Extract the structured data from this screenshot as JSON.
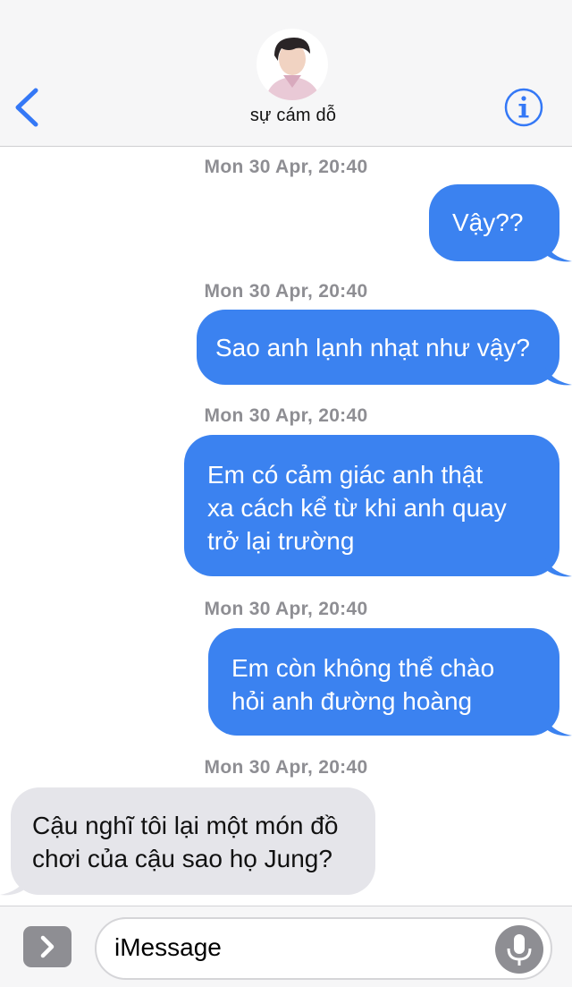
{
  "header": {
    "contact_name": "sự cám dỗ",
    "back_icon": "chevron-left-icon",
    "info_icon": "info-icon",
    "accent_color": "#3478f6"
  },
  "messages": [
    {
      "timestamp": "Mon 30 Apr, 20:40",
      "direction": "outgoing",
      "text": "Vậy??"
    },
    {
      "timestamp": "Mon 30 Apr, 20:40",
      "direction": "outgoing",
      "text": "Sao anh lạnh nhạt như vậy?"
    },
    {
      "timestamp": "Mon 30 Apr, 20:40",
      "direction": "outgoing",
      "text": "Em có cảm giác anh thật\nxa cách kể từ khi anh quay\ntrở lại trường"
    },
    {
      "timestamp": "Mon 30 Apr, 20:40",
      "direction": "outgoing",
      "text": "Em còn không thể chào\nhỏi anh đường hoàng"
    },
    {
      "timestamp": "Mon 30 Apr, 20:40",
      "direction": "incoming",
      "text": "Cậu nghĩ tôi lại một món đồ\nchơi của cậu sao họ Jung?"
    }
  ],
  "colors": {
    "outgoing_bubble": "#3b82f0",
    "incoming_bubble": "#e5e5ea",
    "timestamp": "#8e8e93"
  },
  "input_bar": {
    "placeholder": "iMessage",
    "apps_icon": "chevron-right-icon",
    "mic_icon": "microphone-icon"
  }
}
